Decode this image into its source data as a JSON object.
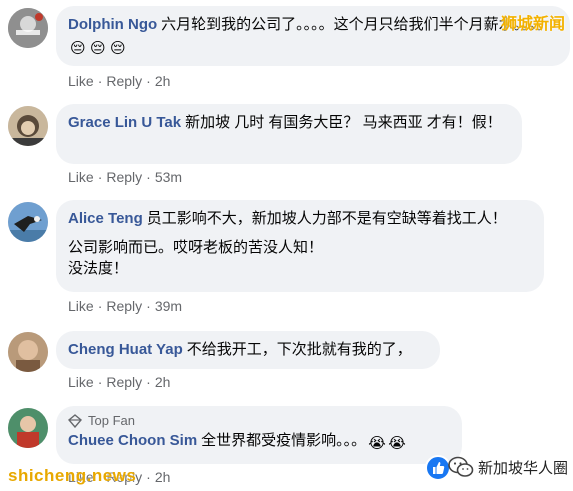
{
  "comments": [
    {
      "name": "Dolphin Ngo",
      "paragraphs": [
        "六月轮到我的公司了。。。。这个月只给我们半个月薪水。。。。"
      ],
      "emojis": [
        "😔",
        "😔",
        "😔"
      ],
      "like": "Like",
      "reply": "Reply",
      "time": "2h"
    },
    {
      "name": "Grace Lin U Tak",
      "paragraphs": [
        "新加坡 几时 有国务大臣？ 马来西亚 才有！假！"
      ],
      "like": "Like",
      "reply": "Reply",
      "time": "53m"
    },
    {
      "name": "Alice Teng",
      "paragraphs": [
        "员工影响不大，新加坡人力部不是有空缺等着找工人！",
        "公司影响而已。哎呀老板的苦没人知！\n没法度！"
      ],
      "like": "Like",
      "reply": "Reply",
      "time": "39m"
    },
    {
      "name": "Cheng Huat Yap",
      "paragraphs": [
        "不给我开工，下次批就有我的了，"
      ],
      "like": "Like",
      "reply": "Reply",
      "time": "2h"
    },
    {
      "badge": "Top Fan",
      "name": "Chuee Choon Sim",
      "paragraphs": [
        "全世界都受疫情影响。。。"
      ],
      "emojis": [
        "😭",
        "😭"
      ],
      "like": "Like",
      "reply": "Reply",
      "time": "2h"
    }
  ],
  "separator": "·",
  "watermarks": {
    "top_right": "狮城新闻",
    "bottom_left": "shicheng.news",
    "bottom_right": "新加坡华人圈"
  },
  "colors": {
    "bubble": "#f0f2f5",
    "name": "#385898",
    "meta": "#65676b",
    "watermark": "#f3b200"
  }
}
